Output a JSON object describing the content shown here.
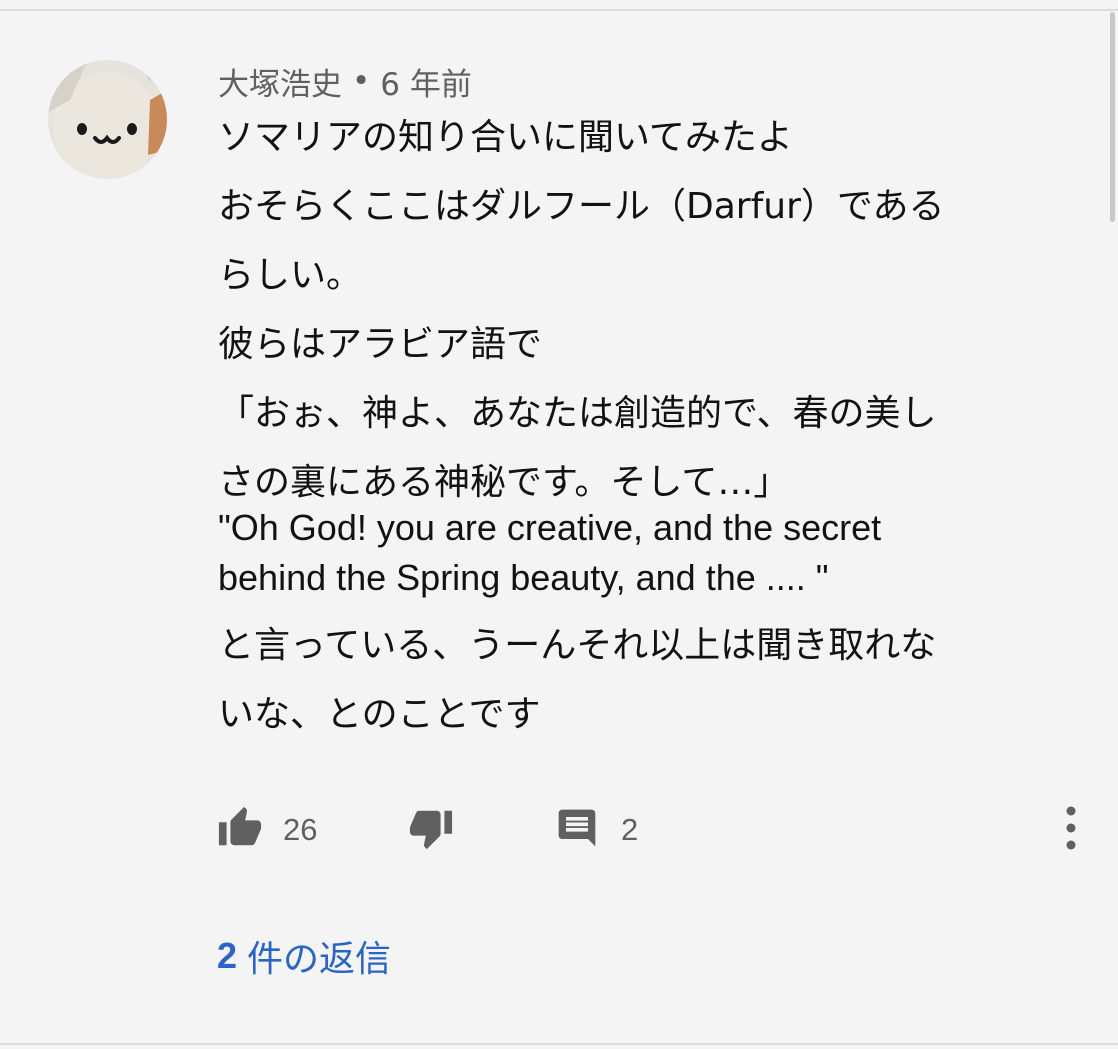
{
  "comment": {
    "author": "大塚浩史",
    "separator": "•",
    "timestamp": "6 年前",
    "lines": [
      "ソマリアの知り合いに聞いてみたよ",
      "おそらくここはダルフール（Darfur）である",
      "らしい。",
      "彼らはアラビア語で",
      "「おぉ、神よ、あなたは創造的で、春の美し",
      "さの裏にある神秘です。そして…」"
    ],
    "english_lines": [
      "\"Oh God! you are creative, and the secret",
      "behind the Spring beauty, and the .... \""
    ],
    "closing_lines": [
      "と言っている、うーんそれ以上は聞き取れな",
      "いな、とのことです"
    ]
  },
  "actions": {
    "like_count": "26",
    "reply_count": "2",
    "icons": [
      "thumbs-up-icon",
      "thumbs-down-icon",
      "comment-icon",
      "more-vert-icon"
    ]
  },
  "replies": {
    "count": "2",
    "label": "件の返信"
  },
  "colors": {
    "background": "#f4f4f4",
    "text": "#121212",
    "secondary_text": "#606060",
    "link": "#2a64c6"
  }
}
